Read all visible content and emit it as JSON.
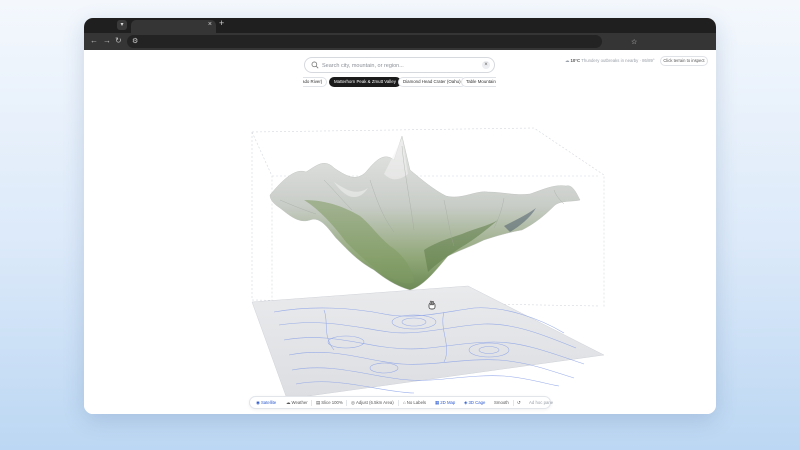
{
  "browser": {
    "tab_dropdown_icon": "chevron-down-icon",
    "tab_close": "×",
    "new_tab": "+",
    "nav": {
      "back": "←",
      "forward": "→",
      "reload": "↻",
      "star": "☆"
    }
  },
  "search": {
    "placeholder": "Search city, mountain, or region...",
    "value": "",
    "clear": "×"
  },
  "weather": {
    "icon": "cloud-icon",
    "temp": "10°C",
    "description": "Thundery outbreaks in nearby · 86/89°"
  },
  "hint_button": "Click terrain to inspect",
  "locations": [
    {
      "label": "ado River)",
      "active": false
    },
    {
      "label": "Matterhorn Peak & Zmutt Valley",
      "active": true
    },
    {
      "label": "Diamond Head Crater (Oahu)",
      "active": false
    },
    {
      "label": "Table Mountain (",
      "active": false
    }
  ],
  "toolbar": {
    "satellite": "Satellite",
    "weather": "Weather",
    "slice": "Slice 100%",
    "adjust": "Adjust (6.5km Area)",
    "no_labels": "No Labels",
    "map2d": "2D Map",
    "cage3d": "3D Cage",
    "smooth": "Smooth",
    "reset_icon": "↺",
    "extra": "Ad hoc pane"
  },
  "colors": {
    "accent": "#2d5bd0",
    "chip_active_bg": "#1b1b1b",
    "contour": "#8ea4e8",
    "browser_dark": "#1f1f1f"
  }
}
